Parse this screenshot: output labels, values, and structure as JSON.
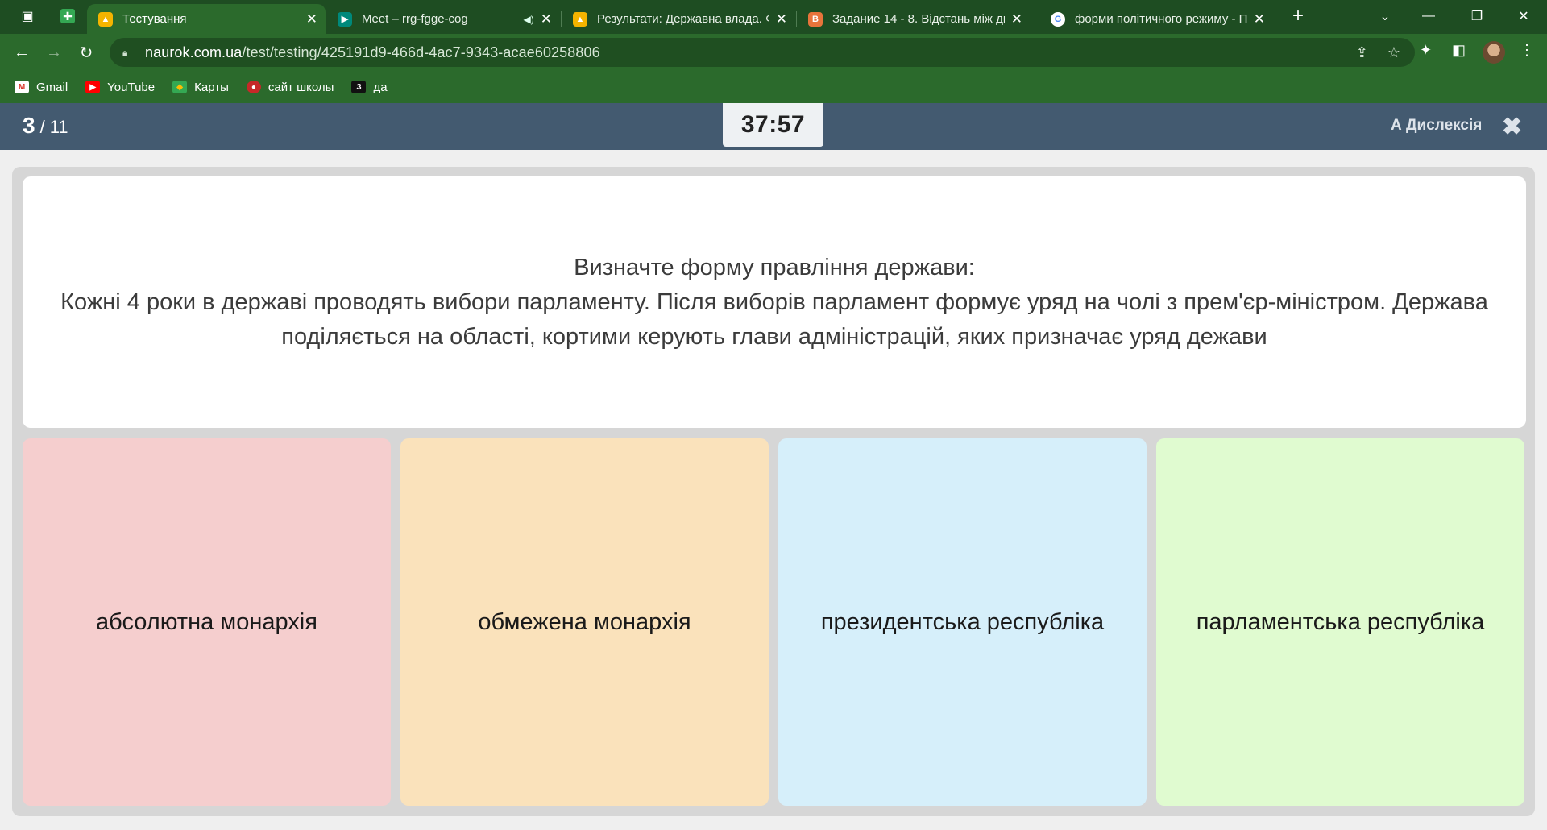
{
  "browser": {
    "tabs": [
      {
        "title": "Тестування",
        "active": true
      },
      {
        "title": "Meet – rrg-fgge-cog",
        "active": false
      },
      {
        "title": "Результати: Державна влада. Ф",
        "active": false
      },
      {
        "title": "Задание 14 - 8. Відстань між дв",
        "active": false
      },
      {
        "title": "форми політичного режиму - П",
        "active": false
      }
    ],
    "new_tab": "+",
    "url_host": "naurok.com.ua",
    "url_path": "/test/testing/425191d9-466d-4ac7-9343-acae60258806",
    "bookmarks": [
      {
        "label": "Gmail",
        "icon": "gmail-icon"
      },
      {
        "label": "YouTube",
        "icon": "youtube-icon"
      },
      {
        "label": "Карты",
        "icon": "maps-icon"
      },
      {
        "label": "сайт школы",
        "icon": "school-site-icon"
      },
      {
        "label": "да",
        "icon": "z-icon",
        "glyph": "З"
      }
    ]
  },
  "quiz": {
    "current": "3",
    "separator": "/",
    "total": "11",
    "timer": "37:57",
    "dyslexia_label": "А Дислексія",
    "question": {
      "line1": "Визначте форму правління держави:",
      "line2": "Кожні 4 роки в державі проводять вибори парламенту. Після виборів парламент формує уряд на чолі з прем'єр-міністром. Держава поділяється на області, кортими керують глави адміністрацій, яких призначає уряд дежави"
    },
    "answers": [
      {
        "label": "абсолютна монархія",
        "color": "#f5cece"
      },
      {
        "label": "обмежена монархія",
        "color": "#fae2bb"
      },
      {
        "label": "президентська республіка",
        "color": "#d6effa"
      },
      {
        "label": "парламентська республіка",
        "color": "#e0fbd0"
      }
    ]
  },
  "colors": {
    "browser_frame": "#1e4d22",
    "browser_toolbar": "#2b6a2c",
    "quiz_header": "#435a70"
  }
}
